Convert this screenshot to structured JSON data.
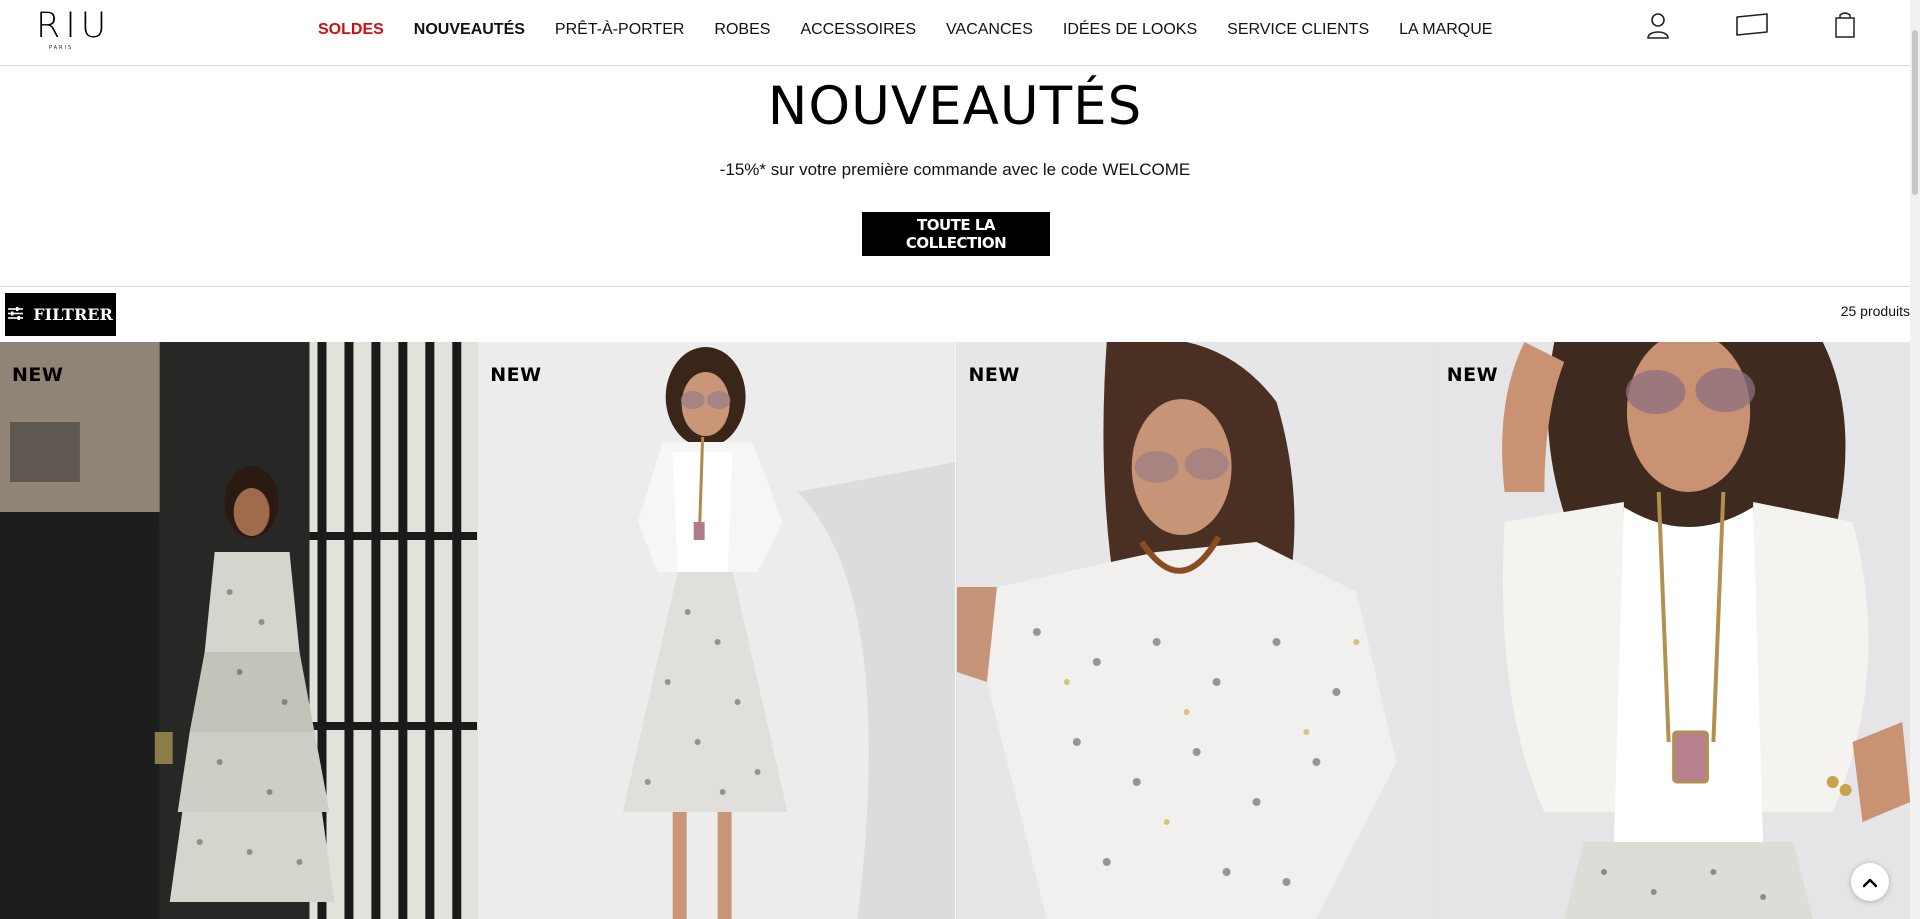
{
  "brand": {
    "name": "RIU",
    "sub": "PARIS"
  },
  "nav": [
    {
      "label": "SOLDES"
    },
    {
      "label": "NOUVEAUTÉS"
    },
    {
      "label": "PRÊT-À-PORTER"
    },
    {
      "label": "ROBES"
    },
    {
      "label": "ACCESSOIRES"
    },
    {
      "label": "VACANCES"
    },
    {
      "label": "IDÉES DE LOOKS"
    },
    {
      "label": "SERVICE CLIENTS"
    },
    {
      "label": "LA MARQUE"
    }
  ],
  "header_icons": [
    "user-icon",
    "gift-card-icon",
    "shopping-bag-icon"
  ],
  "hero": {
    "title": "NOUVEAUTÉS",
    "promo": "-15%* sur votre première commande avec le code WELCOME",
    "cta": "TOUTE LA COLLECTION"
  },
  "filter": {
    "label": "FILTRER",
    "count": "25 produits"
  },
  "products": [
    {
      "badge": "NEW"
    },
    {
      "badge": "NEW"
    },
    {
      "badge": "NEW"
    },
    {
      "badge": "NEW"
    }
  ],
  "colors": {
    "sale": "#d10d0d",
    "button_bg": "#000000",
    "button_text": "#ffffff"
  }
}
